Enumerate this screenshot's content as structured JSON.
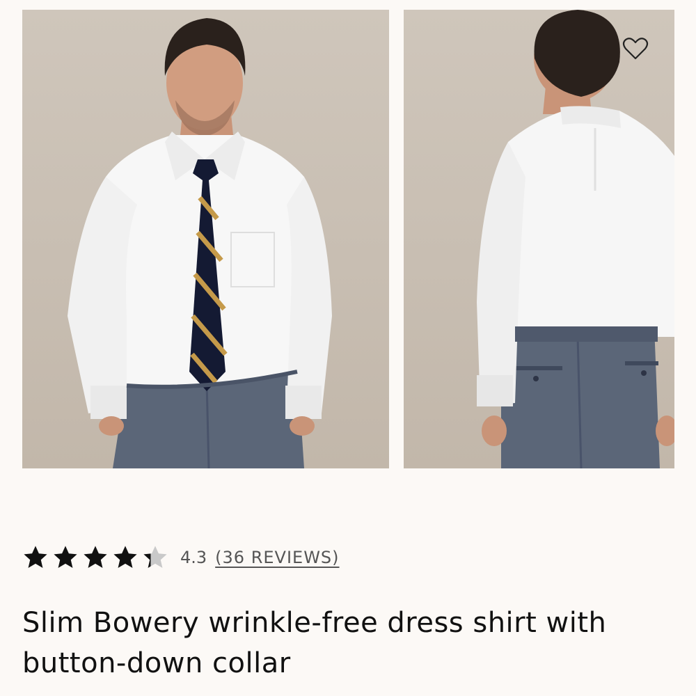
{
  "product": {
    "images": [
      {
        "name": "front view",
        "alt": "Model wearing white dress shirt with striped tie, front view"
      },
      {
        "name": "back view",
        "alt": "Model wearing white dress shirt, back view"
      }
    ],
    "wishlist_icon": "heart-outline-icon",
    "rating": {
      "stars_filled": 4.3,
      "stars_total": 5,
      "value_text": "4.3",
      "reviews_text": "(36 REVIEWS)"
    },
    "title": "Slim Bowery wrinkle-free dress shirt with button-down collar"
  },
  "colors": {
    "background": "#fcf9f6",
    "photo_backdrop": "#c8beb2",
    "star_filled": "#111111",
    "star_empty": "#c9c9c9",
    "text_secondary": "#555555"
  }
}
